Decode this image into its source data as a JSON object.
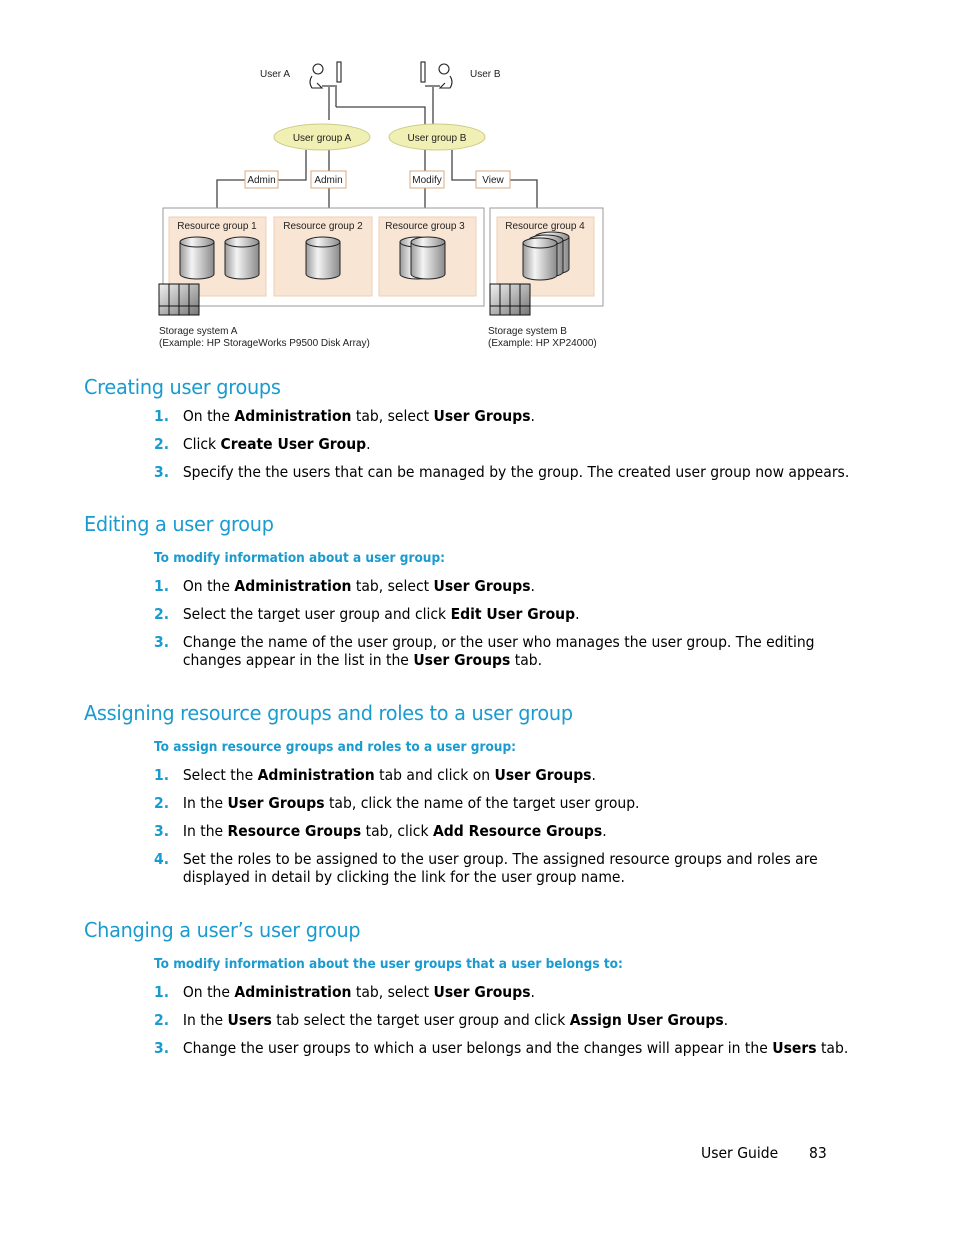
{
  "diagram": {
    "users": [
      {
        "label": "User A"
      },
      {
        "label": "User B"
      }
    ],
    "user_groups": [
      {
        "label": "User group A"
      },
      {
        "label": "User group B"
      }
    ],
    "roles": [
      "Admin",
      "Admin",
      "Modify",
      "View"
    ],
    "resource_groups": [
      {
        "label": "Resource group 1"
      },
      {
        "label": "Resource group 2"
      },
      {
        "label": "Resource group 3"
      },
      {
        "label": "Resource group 4"
      }
    ],
    "storage_systems": [
      {
        "label": "Storage system A",
        "example": "(Example: HP StorageWorks P9500 Disk Array)"
      },
      {
        "label": "Storage system B",
        "example": "(Example: HP XP24000)"
      }
    ],
    "colors": {
      "user_group_fill": "#f0efb4",
      "resource_group_fill": "#f9e5d4",
      "role_border": "#d9a980"
    }
  },
  "sections": [
    {
      "title": "Creating user groups",
      "procedure": "",
      "steps": [
        [
          {
            "t": "On the "
          },
          {
            "b": "Administration"
          },
          {
            "t": " tab, select "
          },
          {
            "b": "User Groups"
          },
          {
            "t": "."
          }
        ],
        [
          {
            "t": "Click "
          },
          {
            "b": "Create User Group"
          },
          {
            "t": "."
          }
        ],
        [
          {
            "t": "Specify the the users that can be managed by the group. The created user group now appears."
          }
        ]
      ]
    },
    {
      "title": "Editing a user group",
      "procedure": "To modify information about a user group:",
      "steps": [
        [
          {
            "t": "On the "
          },
          {
            "b": "Administration"
          },
          {
            "t": " tab, select "
          },
          {
            "b": "User Groups"
          },
          {
            "t": "."
          }
        ],
        [
          {
            "t": "Select the target user group and click "
          },
          {
            "b": "Edit User Group"
          },
          {
            "t": "."
          }
        ],
        [
          {
            "t": "Change the name of the user group, or the user who manages the user group. The editing changes appear in the list in the "
          },
          {
            "b": "User Groups"
          },
          {
            "t": " tab."
          }
        ]
      ]
    },
    {
      "title": "Assigning resource groups and roles to a user group",
      "procedure": "To assign resource groups and roles to a user group:",
      "steps": [
        [
          {
            "t": "Select the "
          },
          {
            "b": "Administration"
          },
          {
            "t": " tab and click on "
          },
          {
            "b": "User Groups"
          },
          {
            "t": "."
          }
        ],
        [
          {
            "t": "In the "
          },
          {
            "b": "User Groups"
          },
          {
            "t": " tab, click the name of the target user group."
          }
        ],
        [
          {
            "t": "In the "
          },
          {
            "b": "Resource Groups"
          },
          {
            "t": " tab, click "
          },
          {
            "b": "Add Resource Groups"
          },
          {
            "t": "."
          }
        ],
        [
          {
            "t": "Set the roles to be assigned to the user group. The assigned resource groups and roles are displayed in detail by clicking the link for the user group name."
          }
        ]
      ]
    },
    {
      "title": "Changing a user’s user group",
      "procedure": "To modify information about the user groups that a user belongs to:",
      "steps": [
        [
          {
            "t": "On the "
          },
          {
            "b": "Administration"
          },
          {
            "t": " tab, select  "
          },
          {
            "b": "User Groups"
          },
          {
            "t": "."
          }
        ],
        [
          {
            "t": "In the "
          },
          {
            "b": "Users"
          },
          {
            "t": " tab select the target user group and click "
          },
          {
            "b": "Assign User Groups"
          },
          {
            "t": "."
          }
        ],
        [
          {
            "t": "Change the user groups to which a user belongs and the changes will appear in the "
          },
          {
            "b": "Users"
          },
          {
            "t": " tab."
          }
        ]
      ]
    }
  ],
  "footer": {
    "label": "User Guide",
    "page": "83"
  },
  "accent_color": "#1a9bd0"
}
